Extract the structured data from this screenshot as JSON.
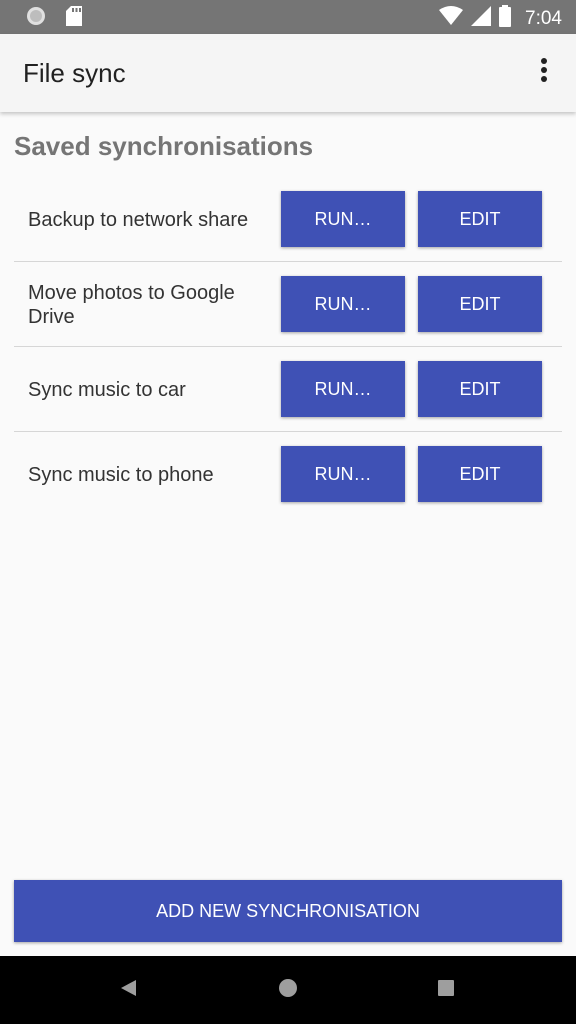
{
  "status_bar": {
    "time": "7:04",
    "icons": [
      "notification-dot-icon",
      "sd-card-icon",
      "wifi-icon",
      "cell-signal-icon",
      "battery-icon"
    ]
  },
  "app_bar": {
    "title": "File sync",
    "menu_icon": "overflow-menu-icon"
  },
  "main": {
    "section_title": "Saved synchronisations",
    "syncs": [
      {
        "name": "Backup to network share",
        "run_label": "RUN…",
        "edit_label": "EDIT"
      },
      {
        "name": "Move photos to Google Drive",
        "run_label": "RUN…",
        "edit_label": "EDIT"
      },
      {
        "name": "Sync music to car",
        "run_label": "RUN…",
        "edit_label": "EDIT"
      },
      {
        "name": "Sync music to phone",
        "run_label": "RUN…",
        "edit_label": "EDIT"
      }
    ],
    "add_button_label": "ADD NEW SYNCHRONISATION"
  },
  "nav_bar": {
    "icons": [
      "back-icon",
      "home-icon",
      "recents-icon"
    ]
  },
  "colors": {
    "accent": "#3f51b5",
    "status_bar": "#757575",
    "app_bar": "#f5f5f5",
    "background": "#fafafa"
  }
}
